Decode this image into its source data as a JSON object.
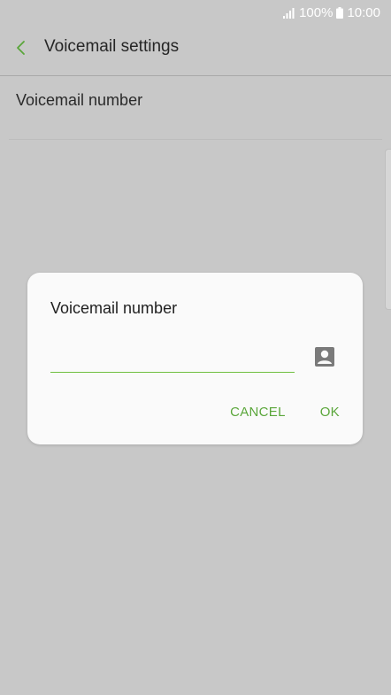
{
  "status_bar": {
    "battery": "100%",
    "time": "10:00"
  },
  "app_bar": {
    "title": "Voicemail settings"
  },
  "settings": {
    "items": [
      {
        "label": "Voicemail number"
      }
    ]
  },
  "dialog": {
    "title": "Voicemail number",
    "input_value": "",
    "cancel_label": "CANCEL",
    "ok_label": "OK"
  },
  "colors": {
    "accent": "#5aa63a",
    "background": "#c8c8c8",
    "dialog": "#fafafa"
  }
}
